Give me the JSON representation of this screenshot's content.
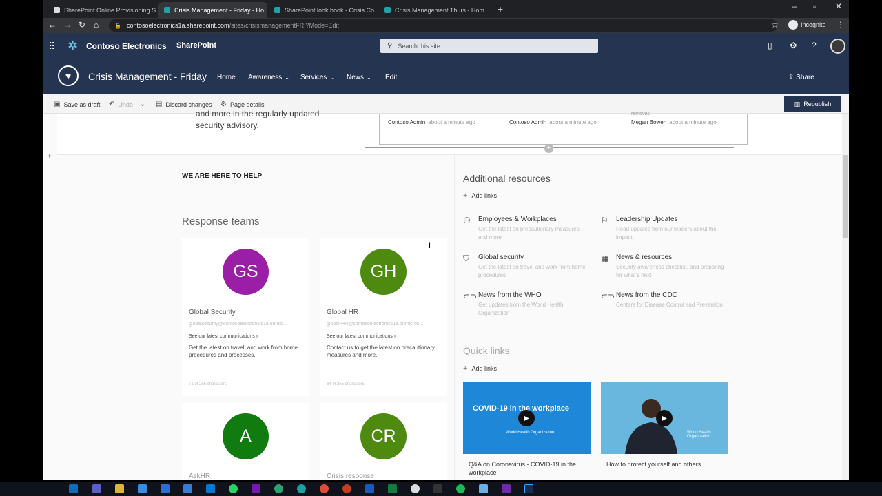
{
  "browser": {
    "tabs": [
      {
        "label": "SharePoint Online Provisioning S",
        "active": false
      },
      {
        "label": "Crisis Management - Friday - Ho",
        "active": true
      },
      {
        "label": "SharePoint look book - Crisis Co",
        "active": false
      },
      {
        "label": "Crisis Management Thurs - Hom",
        "active": false
      }
    ],
    "url_host": "contosoelectronics1a.sharepoint.com",
    "url_path": "/sites/crisismanagementFRI?Mode=Edit",
    "profile": "Incognito"
  },
  "suite": {
    "org": "Contoso Electronics",
    "app": "SharePoint",
    "search_placeholder": "Search this site"
  },
  "site": {
    "title": "Crisis Management - Friday",
    "nav": [
      "Home",
      "Awareness",
      "Services",
      "News",
      "Edit"
    ],
    "share": "Share"
  },
  "commands": {
    "save": "Save as draft",
    "undo": "Undo",
    "discard": "Discard changes",
    "details": "Page details",
    "republish": "Republish"
  },
  "top": {
    "advisory": "and more in the regularly updated security advisory.",
    "truncated": "removes",
    "news_items": [
      {
        "author": "Contoso Admin",
        "ago": "about a minute ago"
      },
      {
        "author": "Contoso Admin",
        "ago": "about a minute ago"
      },
      {
        "author": "Megan Bowen",
        "ago": "about a minute ago"
      }
    ]
  },
  "help_heading": "WE ARE HERE TO HELP",
  "teams": {
    "heading": "Response teams",
    "cards": [
      {
        "initials": "GS",
        "color": "#9b1fa6",
        "name": "Global Security",
        "email": "globalsecurity@contosoelectronics1a.onmic...",
        "link": "See our latest communications »",
        "desc": "Get the latest on travel, and work from home procedures and processes.",
        "count": "71 of 255 characters"
      },
      {
        "initials": "GH",
        "color": "#4f8a10",
        "name": "Global HR",
        "email": "global-HR@contosoelectronics1a.onmicros...",
        "link": "See our latest communications »",
        "desc": "Contact us to get the latest on precautionary measures and more.",
        "count": "64 of 255 characters"
      },
      {
        "initials": "A",
        "color": "#107c10",
        "name": "AskHR"
      },
      {
        "initials": "CR",
        "color": "#4f8a10",
        "name": "Crisis response"
      }
    ]
  },
  "resources": {
    "heading": "Additional resources",
    "add_links": "Add links",
    "items": [
      {
        "icon": "people-icon",
        "title": "Employees & Workplaces",
        "desc": "Get the latest on precautionary measures, and more"
      },
      {
        "icon": "feedback-icon",
        "title": "Leadership Updates",
        "desc": "Read updates from our leaders about the impact"
      },
      {
        "icon": "shield-icon",
        "title": "Global security",
        "desc": "Get the latest on travel and work from home procedures"
      },
      {
        "icon": "news-icon",
        "title": "News & resources",
        "desc": "Security awareness checklist, and preparing for what's next"
      },
      {
        "icon": "link-icon",
        "title": "News from the WHO",
        "desc": "Get updates from the World Health Organization"
      },
      {
        "icon": "link-icon",
        "title": "News from the CDC",
        "desc": "Centers for Disease Control and Prevention"
      }
    ]
  },
  "quicklinks": {
    "heading": "Quick links",
    "add_links": "Add links",
    "video1_text": "COVID-19 in the workplace",
    "video_brand": "World Health Organization",
    "video1_caption": "Q&A on Coronavirus - COVID-19 in the workplace",
    "video2_caption": "How to protect yourself and others"
  }
}
